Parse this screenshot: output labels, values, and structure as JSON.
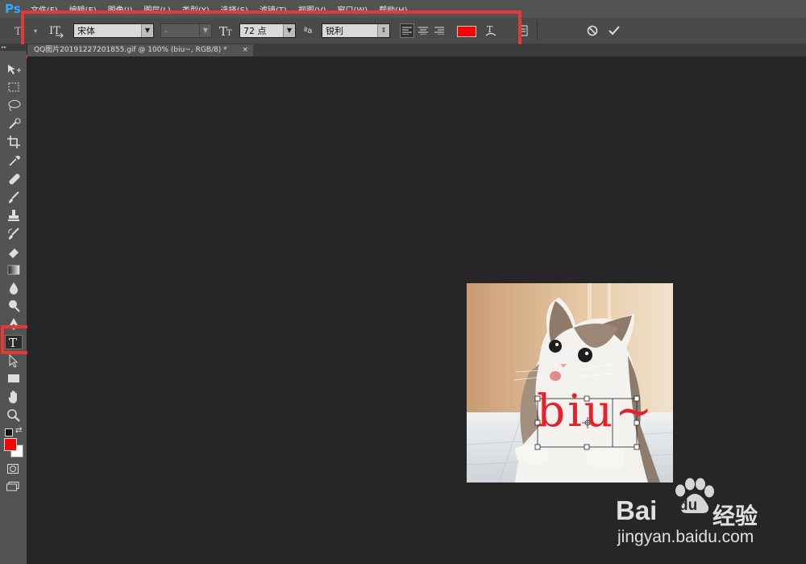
{
  "app": {
    "logo": "Ps"
  },
  "menu": [
    "文件(F)",
    "编辑(E)",
    "图像(I)",
    "图层(L)",
    "类型(Y)",
    "选择(S)",
    "滤镜(T)",
    "视图(V)",
    "窗口(W)",
    "帮助(H)"
  ],
  "options": {
    "font_family": "宋体",
    "font_style": "-",
    "font_size": "72 点",
    "aa_label": "ªa",
    "anti_alias": "锐利",
    "text_color": "#ff0000"
  },
  "document": {
    "tab_title": "QQ图片20191227201855.gif @ 100% (biu~, RGB/8) *",
    "close": "×"
  },
  "canvas": {
    "text": "biu~",
    "text_color": "#e8202a"
  },
  "toolbox": {
    "tools": [
      "move-tool",
      "marquee-tool",
      "lasso-tool",
      "quick-select-tool",
      "crop-tool",
      "eyedropper-tool",
      "healing-tool",
      "brush-tool",
      "stamp-tool",
      "history-brush-tool",
      "eraser-tool",
      "gradient-tool",
      "blur-tool",
      "dodge-tool",
      "pen-tool",
      "type-tool",
      "path-select-tool",
      "rectangle-tool",
      "hand-tool",
      "zoom-tool"
    ],
    "active_tool": "type-tool",
    "foreground_color": "#ff0000",
    "background_color": "#ffffff"
  },
  "watermark": {
    "brand": "Bai",
    "brand_du": "du",
    "suffix": "经验",
    "url": "jingyan.baidu.com"
  }
}
